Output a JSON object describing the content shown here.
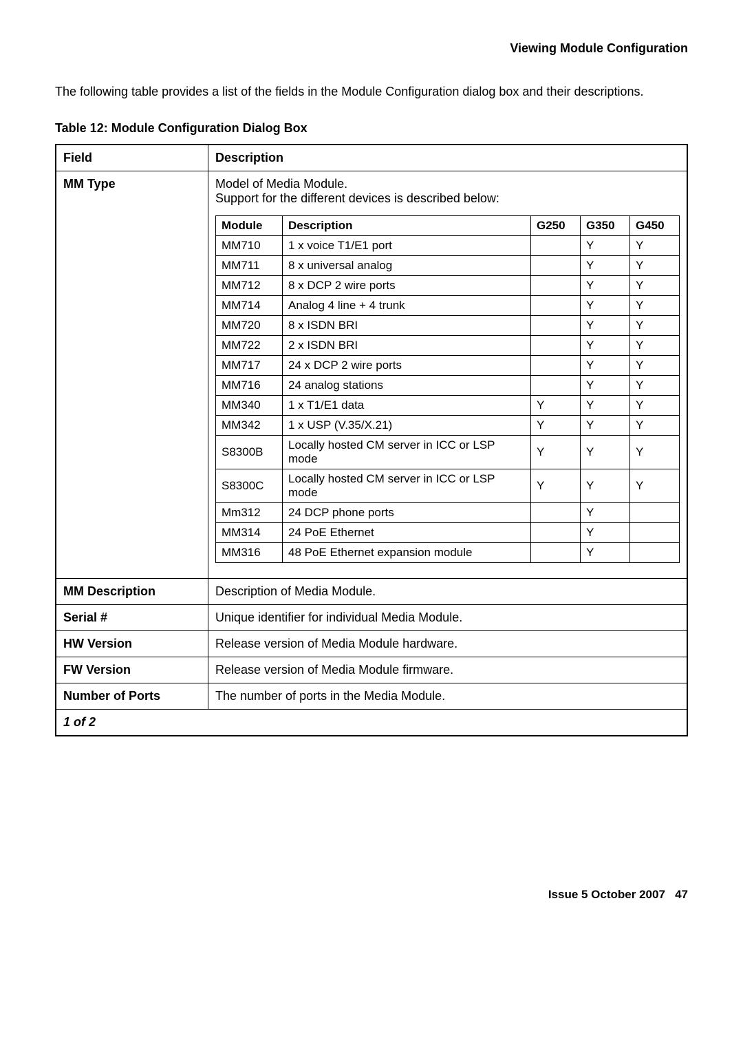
{
  "header": {
    "section_title": "Viewing Module Configuration"
  },
  "intro": "The following table provides a list of the fields in the Module Configuration dialog box and their descriptions.",
  "table_title": "Table 12: Module Configuration Dialog Box",
  "outer_headers": {
    "field": "Field",
    "description": "Description"
  },
  "mm_type": {
    "label": "MM Type",
    "line1": "Model of Media Module.",
    "line2": "Support for the different devices is described below:",
    "inner_headers": {
      "module": "Module",
      "description": "Description",
      "g250": "G250",
      "g350": "G350",
      "g450": "G450"
    },
    "rows": [
      {
        "module": "MM710",
        "desc": "1 x voice T1/E1 port",
        "g250": "",
        "g350": "Y",
        "g450": "Y"
      },
      {
        "module": "MM711",
        "desc": "8 x universal analog",
        "g250": "",
        "g350": "Y",
        "g450": "Y"
      },
      {
        "module": "MM712",
        "desc": "8 x DCP 2 wire ports",
        "g250": "",
        "g350": "Y",
        "g450": "Y"
      },
      {
        "module": "MM714",
        "desc": "Analog 4 line + 4 trunk",
        "g250": "",
        "g350": "Y",
        "g450": "Y"
      },
      {
        "module": "MM720",
        "desc": "8 x ISDN BRI",
        "g250": "",
        "g350": "Y",
        "g450": "Y"
      },
      {
        "module": "MM722",
        "desc": "2 x ISDN BRI",
        "g250": "",
        "g350": "Y",
        "g450": "Y"
      },
      {
        "module": "MM717",
        "desc": "24 x DCP 2 wire ports",
        "g250": "",
        "g350": "Y",
        "g450": "Y"
      },
      {
        "module": "MM716",
        "desc": "24 analog stations",
        "g250": "",
        "g350": "Y",
        "g450": "Y"
      },
      {
        "module": "MM340",
        "desc": "1 x T1/E1 data",
        "g250": "Y",
        "g350": "Y",
        "g450": "Y"
      },
      {
        "module": "MM342",
        "desc": "1 x USP (V.35/X.21)",
        "g250": "Y",
        "g350": "Y",
        "g450": "Y"
      },
      {
        "module": "S8300B",
        "desc": "Locally hosted CM server in ICC or LSP mode",
        "g250": "Y",
        "g350": "Y",
        "g450": "Y"
      },
      {
        "module": "S8300C",
        "desc": "Locally hosted CM server in ICC or LSP mode",
        "g250": "Y",
        "g350": "Y",
        "g450": "Y"
      },
      {
        "module": "Mm312",
        "desc": "24 DCP phone  ports",
        "g250": "",
        "g350": "Y",
        "g450": ""
      },
      {
        "module": "MM314",
        "desc": "24 PoE Ethernet",
        "g250": "",
        "g350": "Y",
        "g450": ""
      },
      {
        "module": "MM316",
        "desc": "48 PoE Ethernet expansion module",
        "g250": "",
        "g350": "Y",
        "g450": ""
      }
    ]
  },
  "other_rows": [
    {
      "field": "MM Description",
      "desc": "Description of Media Module."
    },
    {
      "field": "Serial #",
      "desc": "Unique identifier for individual Media Module."
    },
    {
      "field": "HW Version",
      "desc": "Release version of Media Module hardware."
    },
    {
      "field": "FW Version",
      "desc": "Release version of Media Module firmware."
    },
    {
      "field": "Number of Ports",
      "desc": "The number of ports in the Media Module."
    }
  ],
  "page_of": "1 of 2",
  "footer": {
    "issue": "Issue 5   October 2007",
    "page": "47"
  }
}
